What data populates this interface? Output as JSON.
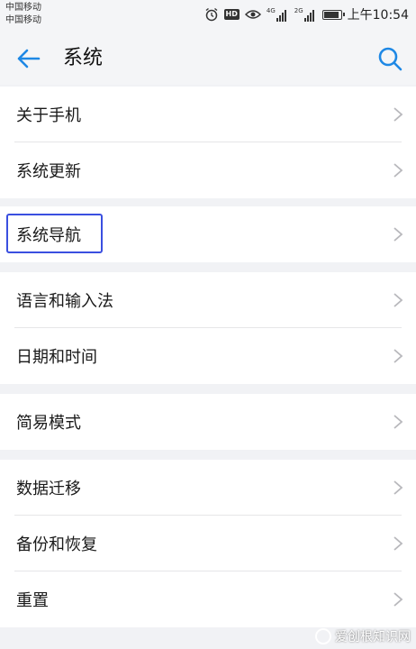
{
  "status_bar": {
    "carrier_1": "中国移动",
    "carrier_2": "中国移动",
    "hd_badge": "HD",
    "net_1": "4G",
    "net_2": "2G",
    "time": "上午10:54"
  },
  "header": {
    "title": "系统",
    "icons": {
      "back": "arrow-left-icon",
      "search": "search-icon"
    }
  },
  "groups": [
    {
      "items": [
        {
          "label": "关于手机"
        },
        {
          "label": "系统更新"
        }
      ]
    },
    {
      "items": [
        {
          "label": "系统导航"
        }
      ]
    },
    {
      "items": [
        {
          "label": "语言和输入法"
        },
        {
          "label": "日期和时间"
        }
      ]
    },
    {
      "items": [
        {
          "label": "简易模式"
        }
      ]
    },
    {
      "items": [
        {
          "label": "数据迁移"
        },
        {
          "label": "备份和恢复"
        },
        {
          "label": "重置"
        }
      ]
    }
  ],
  "watermark": {
    "text": "爱创根知识网"
  },
  "colors": {
    "accent": "#1e88e5",
    "highlight_box": "#3a4fe0",
    "background": "#f1f2f5",
    "card": "#ffffff"
  }
}
